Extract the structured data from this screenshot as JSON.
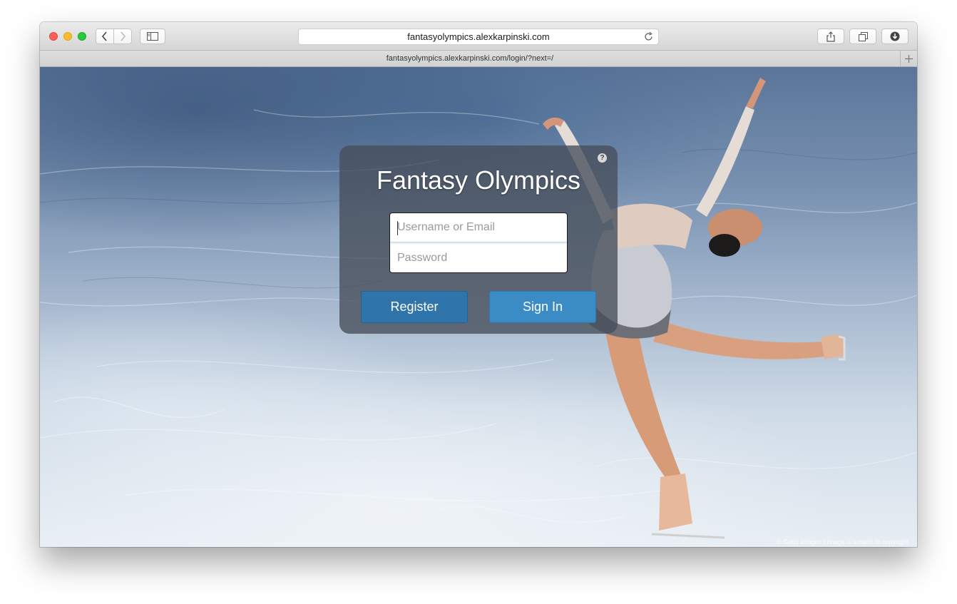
{
  "browser": {
    "address_url": "fantasyolympics.alexkarpinski.com",
    "tab_title": "fantasyolympics.alexkarpinski.com/login/?next=/",
    "icons": [
      "back-icon",
      "forward-icon",
      "sidebar-icon",
      "reload-icon",
      "share-icon",
      "tabs-overview-icon",
      "download-icon",
      "new-tab-icon"
    ]
  },
  "login": {
    "title": "Fantasy Olympics",
    "help_label": "?",
    "username_placeholder": "Username or Email",
    "password_placeholder": "Password",
    "register_label": "Register",
    "signin_label": "Sign In"
  },
  "background": {
    "credit": "© Getty Images | Image is subject to copyright."
  },
  "colors": {
    "register_button": "#2f74aa",
    "signin_button": "#3b8bc4",
    "panel": "rgba(70,78,90,0.78)"
  }
}
